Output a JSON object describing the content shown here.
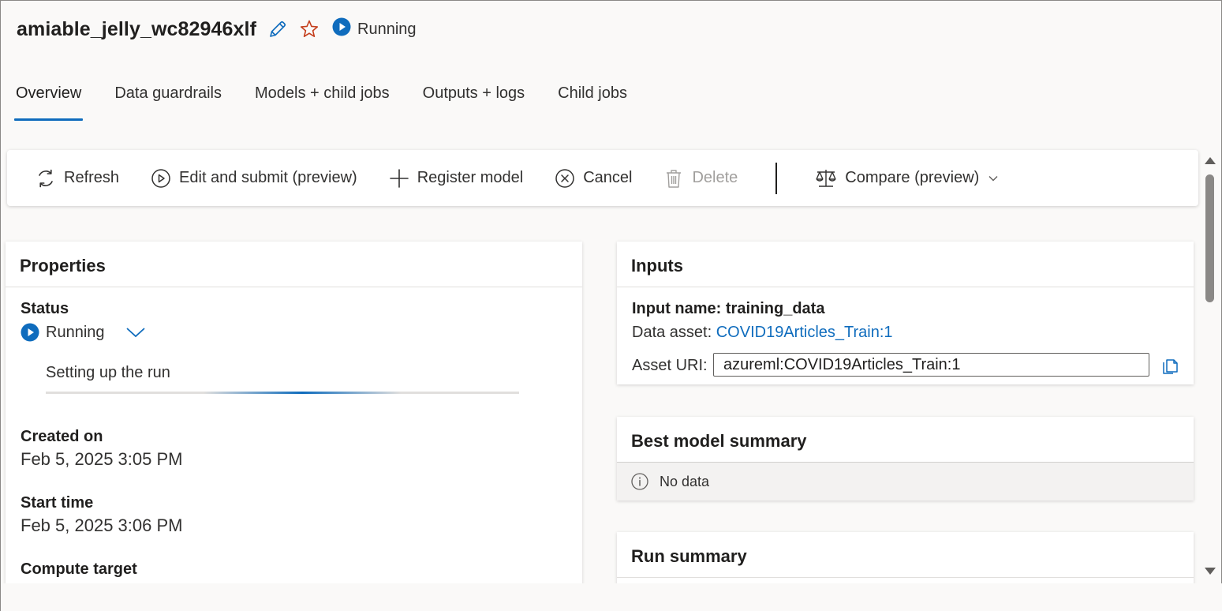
{
  "header": {
    "title": "amiable_jelly_wc82946xlf",
    "status": "Running"
  },
  "tabs": [
    {
      "label": "Overview",
      "active": true
    },
    {
      "label": "Data guardrails",
      "active": false
    },
    {
      "label": "Models + child jobs",
      "active": false
    },
    {
      "label": "Outputs + logs",
      "active": false
    },
    {
      "label": "Child jobs",
      "active": false
    }
  ],
  "toolbar": {
    "refresh": "Refresh",
    "edit_submit": "Edit and submit (preview)",
    "register_model": "Register model",
    "cancel": "Cancel",
    "delete": "Delete",
    "compare": "Compare (preview)"
  },
  "properties": {
    "title": "Properties",
    "status_label": "Status",
    "status_value": "Running",
    "status_detail": "Setting up the run",
    "created_on_label": "Created on",
    "created_on_value": "Feb 5, 2025 3:05 PM",
    "start_time_label": "Start time",
    "start_time_value": "Feb 5, 2025 3:06 PM",
    "compute_target_label": "Compute target"
  },
  "inputs": {
    "title": "Inputs",
    "input_name": "Input name: training_data",
    "data_asset_label": "Data asset:",
    "data_asset_link": "COVID19Articles_Train:1",
    "asset_uri_label": "Asset URI:",
    "asset_uri_value": "azureml:COVID19Articles_Train:1"
  },
  "best_model": {
    "title": "Best model summary",
    "empty_text": "No data"
  },
  "run_summary": {
    "title": "Run summary"
  },
  "colors": {
    "accent": "#0f6cbd",
    "star": "#c43e1c",
    "disabled": "#a19f9d"
  },
  "icons": {
    "edit": "pencil-icon",
    "favorite": "star-icon",
    "status": "play-circle-icon",
    "refresh": "refresh-icon",
    "edit_submit": "play-outline-icon",
    "register": "plus-icon",
    "cancel": "cancel-circle-icon",
    "delete": "trash-icon",
    "compare": "scales-icon",
    "copy": "copy-icon",
    "info": "info-icon"
  }
}
